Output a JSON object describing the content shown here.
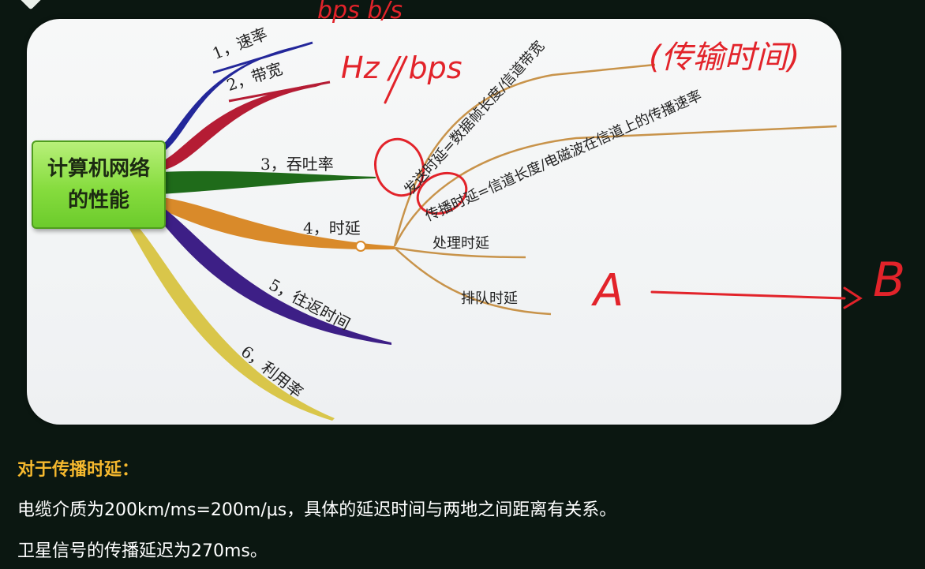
{
  "mindmap": {
    "root": {
      "line1": "计算机网络",
      "line2": "的性能"
    },
    "branches": [
      {
        "label": "1，速率",
        "color": "#23279a"
      },
      {
        "label": "2，带宽",
        "color": "#b51c34"
      },
      {
        "label": "3，吞吐率",
        "color": "#1f6b1a"
      },
      {
        "label": "4，时延",
        "color": "#d98a2a"
      },
      {
        "label": "5，往返时间",
        "color": "#3d1f86"
      },
      {
        "label": "6，利用率",
        "color": "#d9c64a"
      }
    ],
    "delay_children": [
      "发送时延=数据帧长度/信道带宽",
      "传播时延=信道长度/电磁波在信道上的传播速率",
      "处理时延",
      "排队时延"
    ],
    "annotations": {
      "rate_units": "bps  b/s",
      "bandwidth_units": "Hz / bps",
      "transmission_note": "(传输时间)",
      "point_a": "A",
      "point_b": "B"
    }
  },
  "caption": {
    "heading": "对于传播时延：",
    "line1": "电缆介质为200km/ms=200m/μs，具体的延迟时间与两地之间距离有关系。",
    "line2": "卫星信号的传播延迟为270ms。",
    "heading_color": "#f5b82e",
    "text_color": "#ffffff"
  }
}
